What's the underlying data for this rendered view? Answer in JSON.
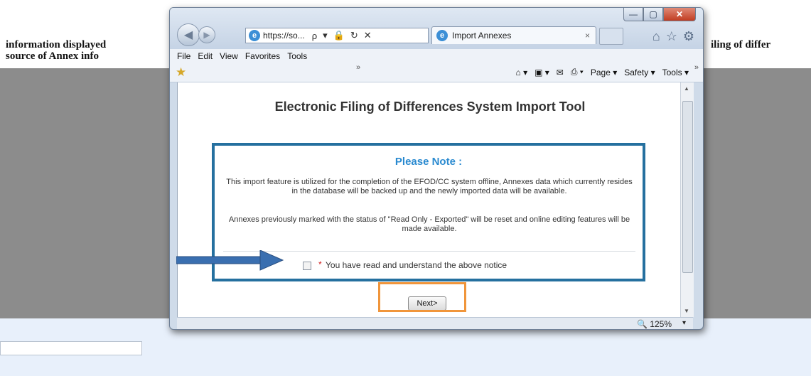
{
  "background": {
    "left_text_line1": "information displayed",
    "left_text_line2": "source of Annex info",
    "right_text": "iling of differ"
  },
  "window": {
    "controls": {
      "minimize": "—",
      "maximize": "▢",
      "close": "✕"
    },
    "address": {
      "url": "https://so...",
      "search": "ρ",
      "dropdown": "▾",
      "lock": "🔒",
      "refresh": "↻",
      "stop": "✕"
    },
    "tab": {
      "label": "Import Annexes",
      "close": "×"
    },
    "menu": [
      "File",
      "Edit",
      "View",
      "Favorites",
      "Tools"
    ],
    "command_bar": {
      "overflow": "»",
      "page": "Page ▾",
      "safety": "Safety ▾",
      "tools": "Tools ▾"
    },
    "status": {
      "zoom": "125%",
      "zoom_arrow": "▾"
    }
  },
  "page": {
    "title": "Electronic Filing of Differences System Import Tool",
    "notice_title": "Please Note :",
    "notice_p1": "This import feature is utilized for the completion of the EFOD/CC system offline, Annexes data which currently resides in the database will be backed up and the newly imported data will be available.",
    "notice_p2": "Annexes previously marked with the status of \"Read Only - Exported\" will be reset and online editing features will be made available.",
    "required_mark": "*",
    "checkbox_label": "You have read and understand the above notice",
    "next_button": "Next>"
  },
  "colors": {
    "notice_border": "#25709f",
    "notice_title": "#2a8ad0",
    "annotation_orange": "#f0953b",
    "annotation_arrow": "#3a6fb0"
  }
}
